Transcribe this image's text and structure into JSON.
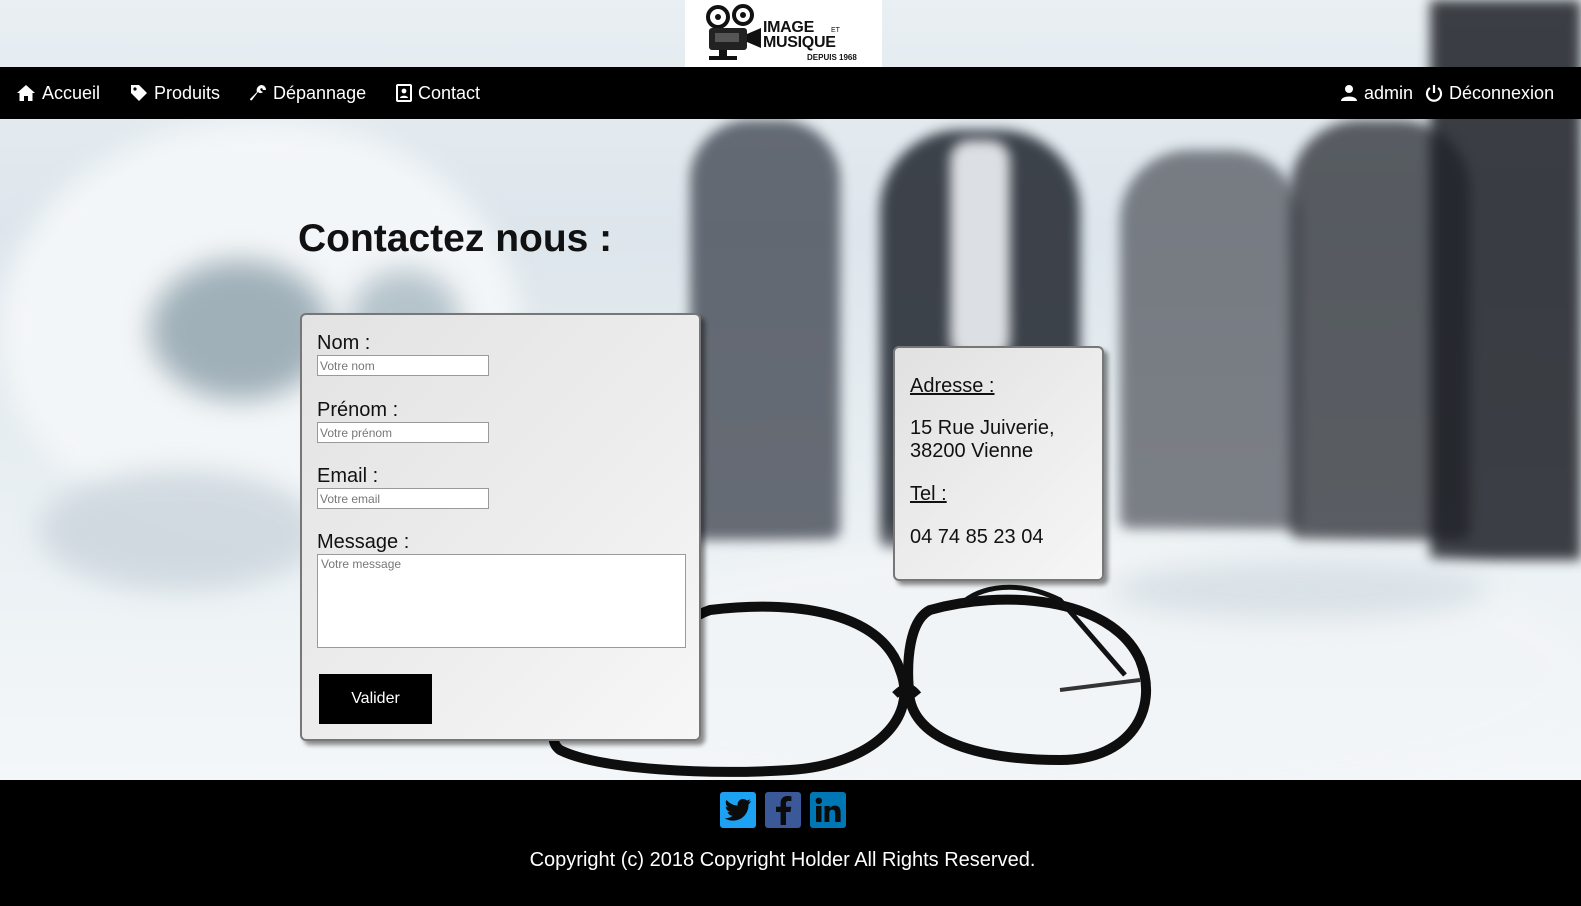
{
  "logo": {
    "line1": "IMAGE",
    "line2": "MUSIQUE",
    "et": "ET",
    "since": "DEPUIS 1968"
  },
  "nav": {
    "left": [
      {
        "label": "Accueil",
        "icon": "home-icon"
      },
      {
        "label": "Produits",
        "icon": "tag-icon"
      },
      {
        "label": "Dépannage",
        "icon": "wrench-icon"
      },
      {
        "label": "Contact",
        "icon": "contact-card-icon"
      }
    ],
    "user": {
      "label": "admin",
      "icon": "user-icon"
    },
    "logout": {
      "label": "Déconnexion",
      "icon": "power-icon"
    }
  },
  "page": {
    "title": "Contactez nous :"
  },
  "form": {
    "nom": {
      "label": "Nom :",
      "placeholder": "Votre nom"
    },
    "prenom": {
      "label": "Prénom :",
      "placeholder": "Votre prénom"
    },
    "email": {
      "label": "Email :",
      "placeholder": "Votre email"
    },
    "message": {
      "label": "Message :",
      "placeholder": "Votre message"
    },
    "submit": "Valider"
  },
  "info": {
    "address_heading": "Adresse :",
    "address_line1": "15 Rue Juiverie,",
    "address_line2": "38200 Vienne",
    "tel_heading": "Tel :",
    "tel_value": "04 74 85 23 04"
  },
  "footer": {
    "social": [
      {
        "name": "twitter-icon",
        "color": "#1da1f2"
      },
      {
        "name": "facebook-icon",
        "color": "#3b5998"
      },
      {
        "name": "linkedin-icon",
        "color": "#0077b5"
      }
    ],
    "copyright": "Copyright (c) 2018 Copyright Holder All Rights Reserved."
  },
  "colors": {
    "navbar": "#000000",
    "footer": "#000000",
    "button": "#000000"
  }
}
